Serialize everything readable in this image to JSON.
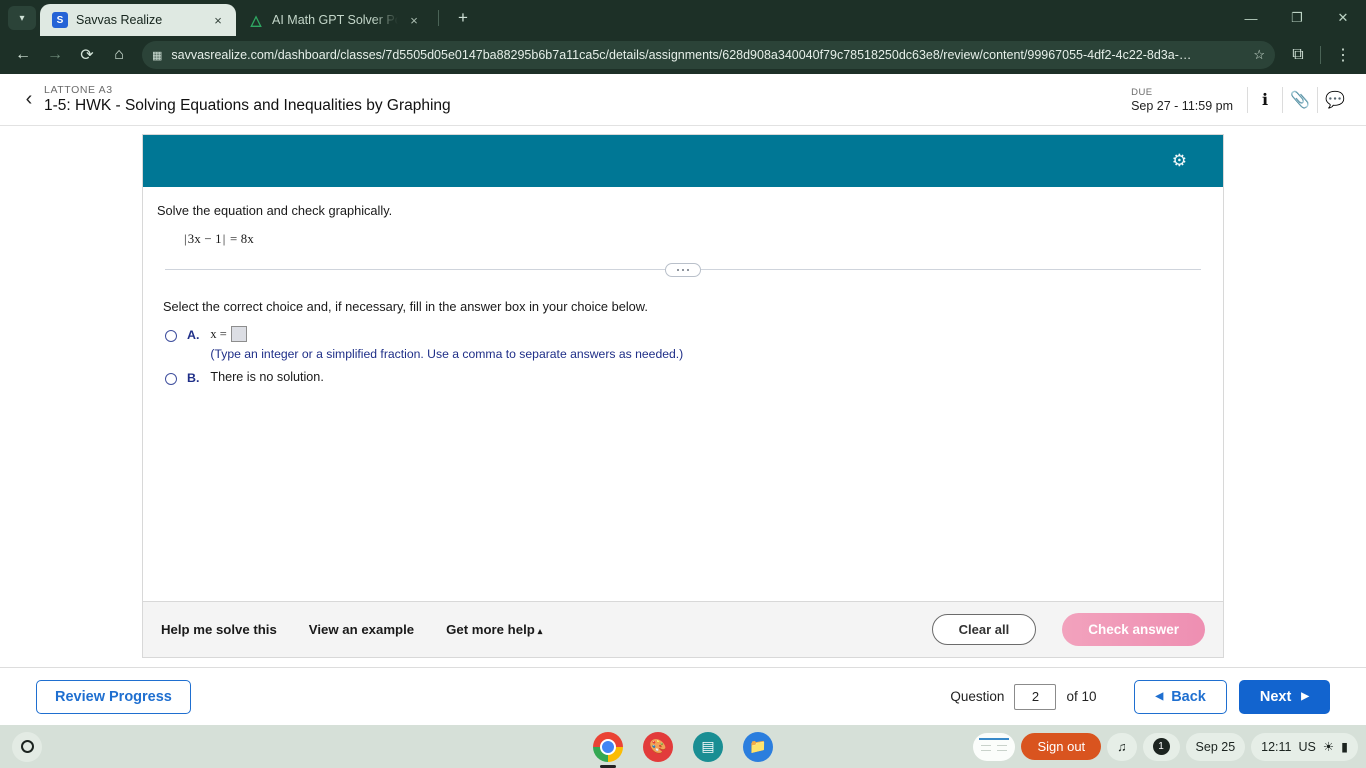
{
  "browser": {
    "tabs": [
      {
        "title": "Savvas Realize",
        "favicon": "savvas-logo-icon",
        "active": true,
        "close_label": "×"
      },
      {
        "title": "AI Math GPT Solver Powered by",
        "favicon": "gpt-logo-icon",
        "active": false,
        "close_label": "×"
      }
    ],
    "new_tab_label": "+",
    "tab_list_chevron": "▾",
    "nav": {
      "back": "←",
      "forward": "→",
      "reload": "⟳",
      "home": "⌂"
    },
    "omnibox": {
      "site_icon": "page-info-icon",
      "url": "savvasrealize.com/dashboard/classes/7d5505d05e0147ba88295b6b7a11ca5c/details/assignments/628d908a340040f79c78518250dc63e8/review/content/99967055-4df2-4c22-8d3a-…",
      "star": "☆"
    },
    "extensions_icon": "⧉",
    "menu_icon": "⋮",
    "window_controls": {
      "minimize": "—",
      "maximize": "❐",
      "close": "✕"
    }
  },
  "app_header": {
    "back_chevron": "‹",
    "class_name": "LATTONE A3",
    "assignment_title": "1-5: HWK - Solving Equations and Inequalities by Graphing",
    "due_label": "DUE",
    "due_value": "Sep 27 - 11:59 pm",
    "info_icon": "ℹ",
    "attach_icon": "📎",
    "comment_icon": "💬"
  },
  "exercise": {
    "settings_icon": "⚙",
    "prompt": "Solve the equation and check graphically.",
    "equation_lhs_bar": "|",
    "equation_lhs": "3x − 1",
    "equation_rhs": "= 8x",
    "select_instruction": "Select the correct choice and, if necessary, fill in the answer box in your choice below.",
    "choices": [
      {
        "letter": "A.",
        "x_label": "x =",
        "answer_value": "",
        "hint": "(Type an integer or a simplified fraction. Use a comma to separate answers as needed.)"
      },
      {
        "letter": "B.",
        "text": "There is no solution."
      }
    ],
    "footer": {
      "help_me_solve": "Help me solve this",
      "view_example": "View an example",
      "get_more_help": "Get more help",
      "get_more_help_caret": "▴",
      "clear_all": "Clear all",
      "check_answer": "Check answer"
    }
  },
  "page_nav": {
    "review_progress": "Review Progress",
    "question_label": "Question",
    "question_number": "2",
    "of_label": "of 10",
    "back": "Back",
    "back_caret": "◀",
    "next": "Next",
    "next_caret": "▶"
  },
  "shelf": {
    "launcher": "launcher-icon",
    "apps": [
      {
        "name": "chrome-icon",
        "glyph": ""
      },
      {
        "name": "canvas-icon",
        "glyph": "🎨"
      },
      {
        "name": "slides-icon",
        "glyph": "▤"
      },
      {
        "name": "files-icon",
        "glyph": "📁"
      }
    ],
    "sign_out": "Sign out",
    "playlist_icon": "♫",
    "notification_count": "1",
    "date": "Sep 25",
    "time": "12:11",
    "locale": "US",
    "wifi_icon": "▼",
    "battery_icon": "▯"
  },
  "colors": {
    "teal_bar": "#007795",
    "blue_primary": "#1264cf",
    "choice_blue": "#1f2f88",
    "check_pink": "#ee8fb2",
    "signout_orange": "#d9541f"
  }
}
